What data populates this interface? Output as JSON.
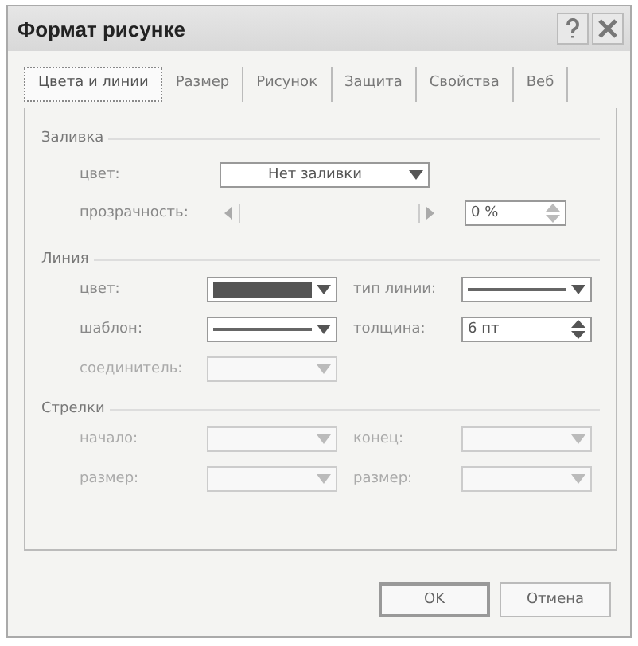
{
  "window": {
    "title": "Формат рисунке"
  },
  "tabs": [
    {
      "label": "Цвета и линии",
      "selected": true
    },
    {
      "label": "Размер",
      "selected": false
    },
    {
      "label": "Рисунок",
      "selected": false
    },
    {
      "label": "Защита",
      "selected": false
    },
    {
      "label": "Свойства",
      "selected": false
    },
    {
      "label": "Веб",
      "selected": false
    }
  ],
  "fill": {
    "title": "Заливка",
    "color": {
      "label": "цвет:",
      "value": "Нет заливки"
    },
    "transparency": {
      "label": "прозрачность:",
      "level": 0,
      "value": "0 %"
    }
  },
  "line": {
    "title": "Линия",
    "fields": [
      {
        "label": "цвет:",
        "kind": "color",
        "color": "#555555",
        "disabled": false
      },
      {
        "label": "тип линии:",
        "kind": "line",
        "disabled": false
      },
      {
        "label": "шаблон:",
        "kind": "line",
        "disabled": false
      },
      {
        "label": "толщина:",
        "kind": "spinner",
        "value": "6 пт",
        "disabled": false
      },
      {
        "label": "соединитель:",
        "kind": "dropdown",
        "disabled": true
      }
    ]
  },
  "arrows": {
    "title": "Стрелки",
    "fields": [
      {
        "label": "начало:",
        "kind": "dropdown",
        "disabled": true
      },
      {
        "label": "конец:",
        "kind": "dropdown",
        "disabled": true
      },
      {
        "label": "размер:",
        "kind": "dropdown",
        "disabled": true
      },
      {
        "label": "размер:",
        "kind": "dropdown",
        "disabled": true
      }
    ]
  },
  "buttons": [
    "OK",
    "Отмена"
  ]
}
